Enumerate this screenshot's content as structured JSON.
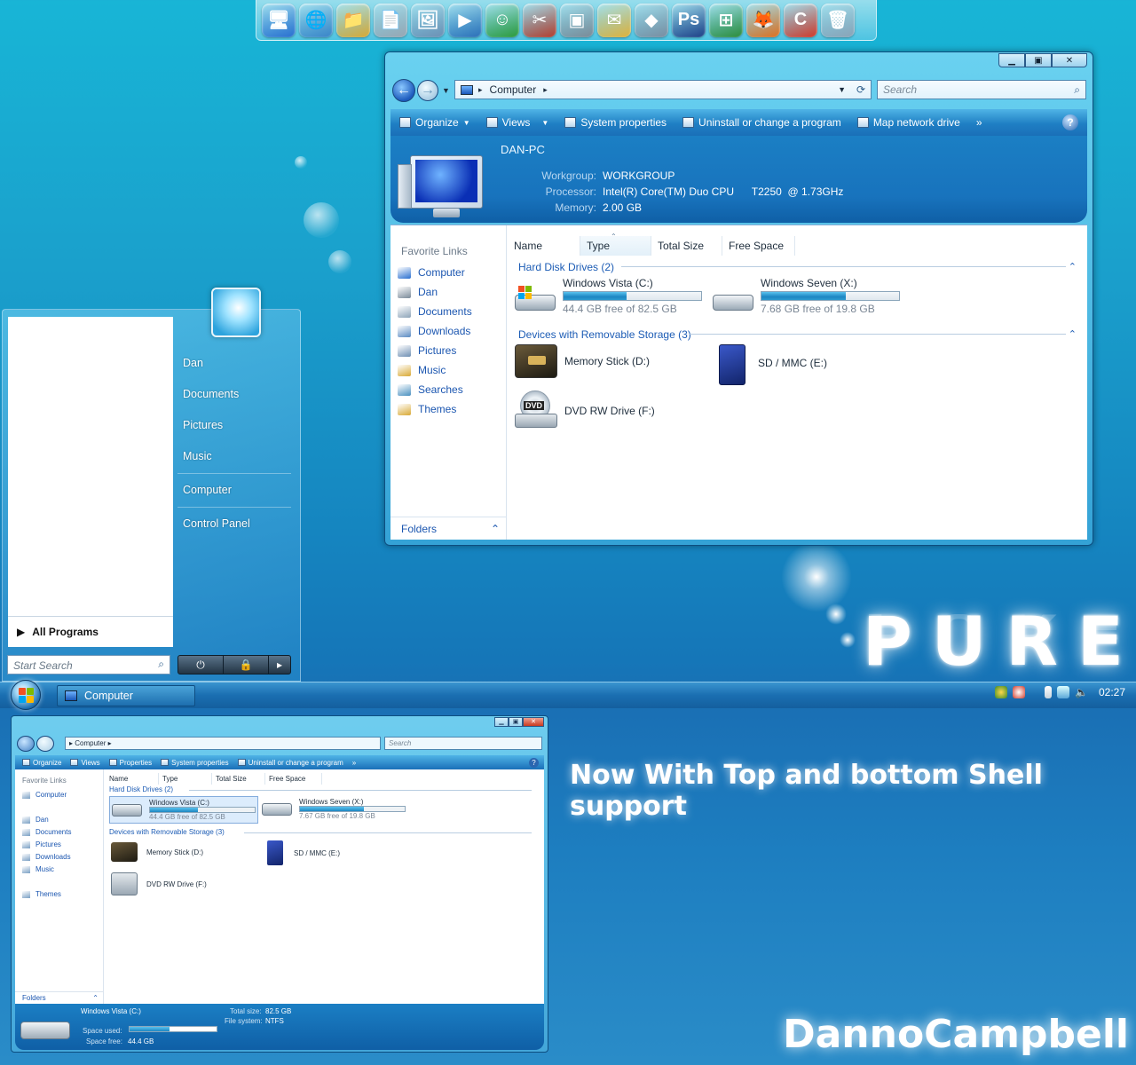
{
  "dock": {
    "icons": [
      {
        "name": "computer-icon",
        "glyph": "🖥",
        "color": "#2a6fd0"
      },
      {
        "name": "network-icon",
        "glyph": "🌐",
        "color": "#3a84c8"
      },
      {
        "name": "folders-icon",
        "glyph": "📁",
        "color": "#d9a935"
      },
      {
        "name": "documents-icon",
        "glyph": "📄",
        "color": "#9aa6b2"
      },
      {
        "name": "pictures-icon",
        "glyph": "🖼",
        "color": "#6e8fb3"
      },
      {
        "name": "media-player-icon",
        "glyph": "▶",
        "color": "#2c6fb8"
      },
      {
        "name": "messenger-icon",
        "glyph": "☺",
        "color": "#2d9a3a"
      },
      {
        "name": "tools-icon",
        "glyph": "✂",
        "color": "#b53d2c"
      },
      {
        "name": "display-icon",
        "glyph": "▣",
        "color": "#7d8a96"
      },
      {
        "name": "mail-icon",
        "glyph": "✉",
        "color": "#e2b23a"
      },
      {
        "name": "cubes-icon",
        "glyph": "◆",
        "color": "#7b8da0"
      },
      {
        "name": "photoshop-icon",
        "glyph": "Ps",
        "color": "#1f3f86"
      },
      {
        "name": "windows-logo-icon",
        "glyph": "⊞",
        "color": "#2d8c3a"
      },
      {
        "name": "firefox-icon",
        "glyph": "🦊",
        "color": "#e0701e"
      },
      {
        "name": "ccleaner-icon",
        "glyph": "C",
        "color": "#d23a2a"
      },
      {
        "name": "recycle-bin-icon",
        "glyph": "🗑",
        "color": "#8ca3b6"
      }
    ]
  },
  "explorer": {
    "address": "Computer",
    "search_placeholder": "Search",
    "toolbar": {
      "organize": "Organize",
      "views": "Views",
      "system_properties": "System properties",
      "uninstall": "Uninstall or change a program",
      "map_drive": "Map network drive",
      "more": "»"
    },
    "details": {
      "pc_name": "DAN-PC",
      "workgroup_label": "Workgroup:",
      "workgroup": "WORKGROUP",
      "processor_label": "Processor:",
      "processor": "Intel(R) Core(TM) Duo CPU      T2250  @ 1.73GHz",
      "memory_label": "Memory:",
      "memory": "2.00 GB"
    },
    "nav": {
      "heading": "Favorite Links",
      "items": [
        "Computer",
        "Dan",
        "Documents",
        "Downloads",
        "Pictures",
        "Music",
        "Searches",
        "Themes"
      ],
      "folders": "Folders"
    },
    "columns": [
      "Name",
      "Type",
      "Total Size",
      "Free Space"
    ],
    "hdd_group": "Hard Disk Drives (2)",
    "removable_group": "Devices with Removable Storage (3)",
    "drives": [
      {
        "name": "Windows Vista (C:)",
        "free": "44.4 GB free of 82.5 GB",
        "used_fraction": 0.46
      },
      {
        "name": "Windows Seven (X:)",
        "free": "7.68 GB free of 19.8 GB",
        "used_fraction": 0.61
      }
    ],
    "removable": [
      "Memory Stick (D:)",
      "SD / MMC (E:)",
      "DVD RW Drive (F:)"
    ]
  },
  "start_menu": {
    "links": [
      "Dan",
      "Documents",
      "Pictures",
      "Music",
      "Computer",
      "Control Panel"
    ],
    "all_programs": "All Programs",
    "search_placeholder": "Start Search"
  },
  "taskbar": {
    "window_button": "Computer",
    "clock": "02:27"
  },
  "small_explorer": {
    "address": "Computer",
    "search_placeholder": "Search",
    "toolbar": [
      "Organize",
      "Views",
      "Properties",
      "System properties",
      "Uninstall or change a program",
      "»"
    ],
    "nav_heading": "Favorite Links",
    "nav_items": [
      "Computer",
      "Dan",
      "Documents",
      "Pictures",
      "Downloads",
      "Music",
      "Themes"
    ],
    "folders": "Folders",
    "columns": [
      "Name",
      "Type",
      "Total Size",
      "Free Space"
    ],
    "hdd_group": "Hard Disk Drives (2)",
    "removable_group": "Devices with Removable Storage (3)",
    "drives": [
      {
        "name": "Windows Vista (C:)",
        "free": "44.4 GB free of 82.5 GB",
        "used_fraction": 0.46
      },
      {
        "name": "Windows Seven (X:)",
        "free": "7.67 GB free of 19.8 GB",
        "used_fraction": 0.61
      }
    ],
    "removable": [
      "Memory Stick (D:)",
      "SD / MMC (E:)",
      "DVD RW Drive (F:)"
    ],
    "detail": {
      "drive": "Windows Vista (C:)",
      "space_used_label": "Space used:",
      "space_free_label": "Space free:",
      "space_free": "44.4 GB",
      "total_size_label": "Total size:",
      "total_size": "82.5 GB",
      "fs_label": "File system:",
      "fs": "NTFS",
      "used_fraction": 0.46
    }
  },
  "promo": {
    "title": "PURE",
    "slogan": "Now With Top and bottom Shell support",
    "author": "DannoCampbell"
  },
  "colors": {
    "accent": "#1873bd",
    "link": "#1b56b0",
    "group": "#1c5cb5"
  }
}
